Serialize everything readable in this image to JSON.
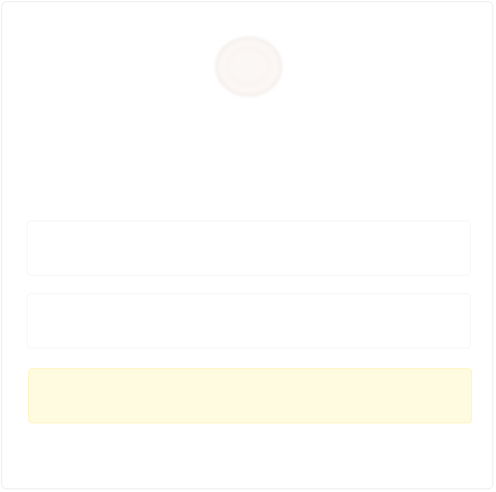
{
  "brand": {
    "logo_icon": "circular-emblem",
    "name": "",
    "color": "#eaded8"
  },
  "form": {
    "subtitle": "",
    "email_placeholder": "",
    "password_placeholder": "",
    "submit_label": "",
    "submit_color": "#fffbe1",
    "link_label": "",
    "link_color": "#d8f1f6"
  }
}
